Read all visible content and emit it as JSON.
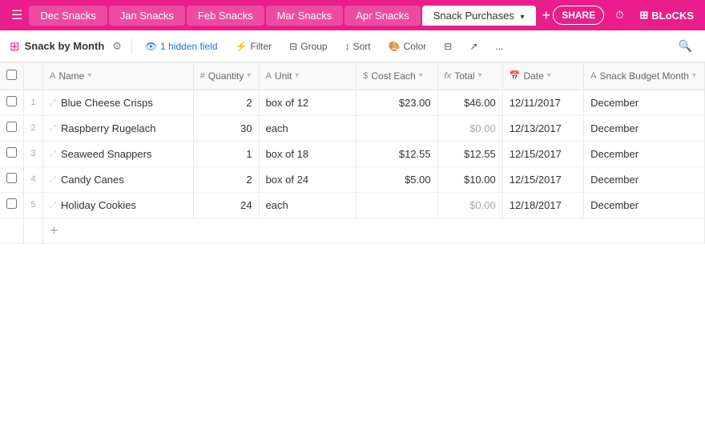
{
  "tabs": [
    {
      "id": "dec",
      "label": "Dec Snacks",
      "active": false
    },
    {
      "id": "jan",
      "label": "Jan Snacks",
      "active": false
    },
    {
      "id": "feb",
      "label": "Feb Snacks",
      "active": false
    },
    {
      "id": "mar",
      "label": "Mar Snacks",
      "active": false
    },
    {
      "id": "apr",
      "label": "Apr Snacks",
      "active": false
    },
    {
      "id": "snack",
      "label": "Snack Purchases",
      "active": true
    }
  ],
  "share_label": "SHARE",
  "blocks_label": "BLoCKS",
  "view_name": "Snack by Month",
  "toolbar": {
    "hidden_field": "1 hidden field",
    "filter": "Filter",
    "group": "Group",
    "sort": "Sort",
    "color": "Color",
    "more": "..."
  },
  "columns": [
    {
      "id": "name",
      "icon": "A",
      "label": "Name",
      "type": "text"
    },
    {
      "id": "qty",
      "icon": "#",
      "label": "Quantity",
      "type": "number"
    },
    {
      "id": "unit",
      "icon": "A",
      "label": "Unit",
      "type": "text"
    },
    {
      "id": "cost",
      "icon": "$",
      "label": "Cost Each",
      "type": "currency"
    },
    {
      "id": "total",
      "icon": "fx",
      "label": "Total",
      "type": "formula"
    },
    {
      "id": "date",
      "icon": "📅",
      "label": "Date",
      "type": "date"
    },
    {
      "id": "budget",
      "icon": "A",
      "label": "Snack Budget Month",
      "type": "text"
    }
  ],
  "rows": [
    {
      "num": 1,
      "name": "Blue Cheese Crisps",
      "qty": "2",
      "unit": "box of 12",
      "cost": "$23.00",
      "total": "$46.00",
      "date": "12/11/2017",
      "budget": "December"
    },
    {
      "num": 2,
      "name": "Raspberry Rugelach",
      "qty": "30",
      "unit": "each",
      "cost": "",
      "total": "$0.00",
      "date": "12/13/2017",
      "budget": "December"
    },
    {
      "num": 3,
      "name": "Seaweed Snappers",
      "qty": "1",
      "unit": "box of 18",
      "cost": "$12.55",
      "total": "$12.55",
      "date": "12/15/2017",
      "budget": "December"
    },
    {
      "num": 4,
      "name": "Candy Canes",
      "qty": "2",
      "unit": "box of 24",
      "cost": "$5.00",
      "total": "$10.00",
      "date": "12/15/2017",
      "budget": "December"
    },
    {
      "num": 5,
      "name": "Holiday Cookies",
      "qty": "24",
      "unit": "each",
      "cost": "",
      "total": "$0.00",
      "date": "12/18/2017",
      "budget": "December"
    }
  ]
}
